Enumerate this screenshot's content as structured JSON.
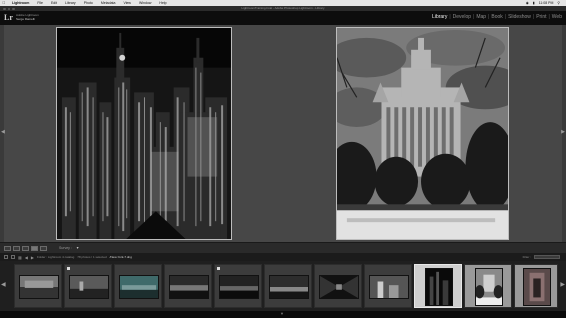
{
  "menubar": {
    "app": "Lightroom",
    "items": [
      "File",
      "Edit",
      "Library",
      "Photo",
      "Metadata",
      "View",
      "Window",
      "Help"
    ],
    "clock": "11:08 PM"
  },
  "window": {
    "title": "LightroomTraining.lrcat - Adobe Photoshop Lightroom - Library"
  },
  "identity": {
    "logo": "Lr",
    "line1": "Adobe Lightroom",
    "line2": "Serge Ramelli"
  },
  "modules": [
    "Library",
    "Develop",
    "Map",
    "Book",
    "Slideshow",
    "Print",
    "Web"
  ],
  "active_module": "Library",
  "toolbar": {
    "sort_label": "Survey :"
  },
  "filmstrip_header": {
    "source": "Folder : Lightroom 4 catalog",
    "count": "78 photos / 1 selected",
    "selected_file": "/New-York-7.dng",
    "filter_label": "Filter :"
  },
  "filmstrip": {
    "thumbnails": [
      {
        "name": "thumb-1",
        "tone": "#555"
      },
      {
        "name": "thumb-2",
        "tone": "#4a4a4a"
      },
      {
        "name": "thumb-3",
        "tone": "#3d5a5a"
      },
      {
        "name": "thumb-4",
        "tone": "#2a2a2a"
      },
      {
        "name": "thumb-5",
        "tone": "#333"
      },
      {
        "name": "thumb-6",
        "tone": "#3a3a3a"
      },
      {
        "name": "thumb-7",
        "tone": "#222"
      },
      {
        "name": "thumb-8",
        "tone": "#444"
      },
      {
        "name": "thumb-9",
        "tone": "#111"
      },
      {
        "name": "thumb-10",
        "tone": "#6a6a6a"
      },
      {
        "name": "thumb-11",
        "tone": "#4a4040"
      }
    ]
  },
  "colors": {
    "accent": "#f0f0f0",
    "panel": "#474747",
    "filmstrip": "#1f1f1f"
  }
}
